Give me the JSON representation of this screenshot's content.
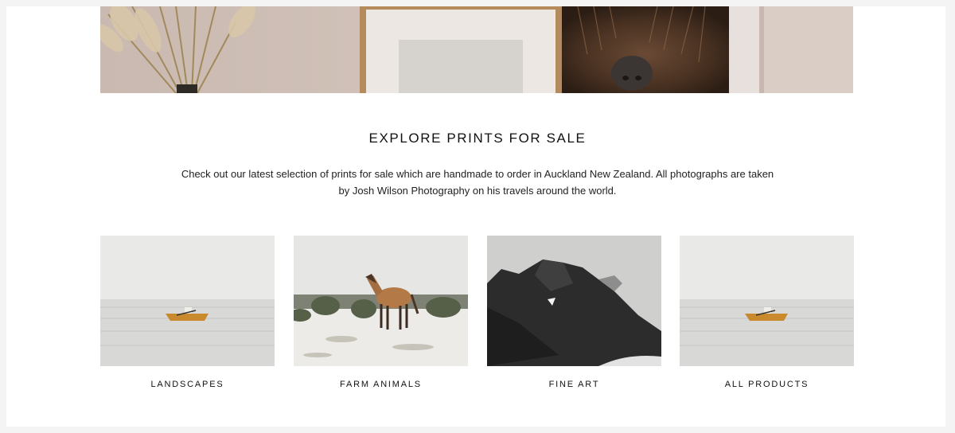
{
  "explore": {
    "heading": "EXPLORE PRINTS FOR SALE",
    "description": "Check out our latest selection of prints for sale which are handmade to order in Auckland New Zealand. All photographs are taken by Josh Wilson Photography on his travels around the world."
  },
  "categories": [
    {
      "label": "LANDSCAPES"
    },
    {
      "label": "FARM ANIMALS"
    },
    {
      "label": "FINE ART"
    },
    {
      "label": "ALL PRODUCTS"
    }
  ]
}
